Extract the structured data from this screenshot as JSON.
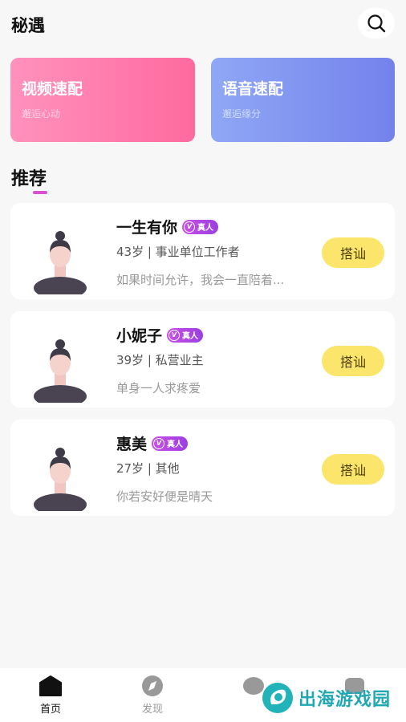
{
  "header": {
    "title": "秘遇"
  },
  "match": {
    "video": {
      "title": "视频速配",
      "subtitle": "邂逅心动"
    },
    "voice": {
      "title": "语音速配",
      "subtitle": "邂逅缘分"
    }
  },
  "recommend": {
    "title": "推荐",
    "users": [
      {
        "name": "一生有你",
        "badge": "真人",
        "info": "43岁 | 事业单位工作者",
        "bio": "如果时间允许，我会一直陪着...",
        "action": "搭讪"
      },
      {
        "name": "小妮子",
        "badge": "真人",
        "info": "39岁 | 私营业主",
        "bio": "单身一人求疼爱",
        "action": "搭讪"
      },
      {
        "name": "惠美",
        "badge": "真人",
        "info": "27岁 | 其他",
        "bio": "你若安好便是晴天",
        "action": "搭讪"
      }
    ]
  },
  "tabbar": {
    "tabs": [
      {
        "label": "首页",
        "icon": "home-icon",
        "active": true
      },
      {
        "label": "发现",
        "icon": "compass-icon",
        "active": false
      }
    ]
  },
  "watermark": {
    "text": "出海游戏园"
  },
  "colors": {
    "accent": "#d94fd6",
    "greet": "#fbe56a",
    "video_gradient": [
      "#ff92bc",
      "#ff6a9e"
    ],
    "voice_gradient": [
      "#8fa8f5",
      "#7481ec"
    ]
  }
}
